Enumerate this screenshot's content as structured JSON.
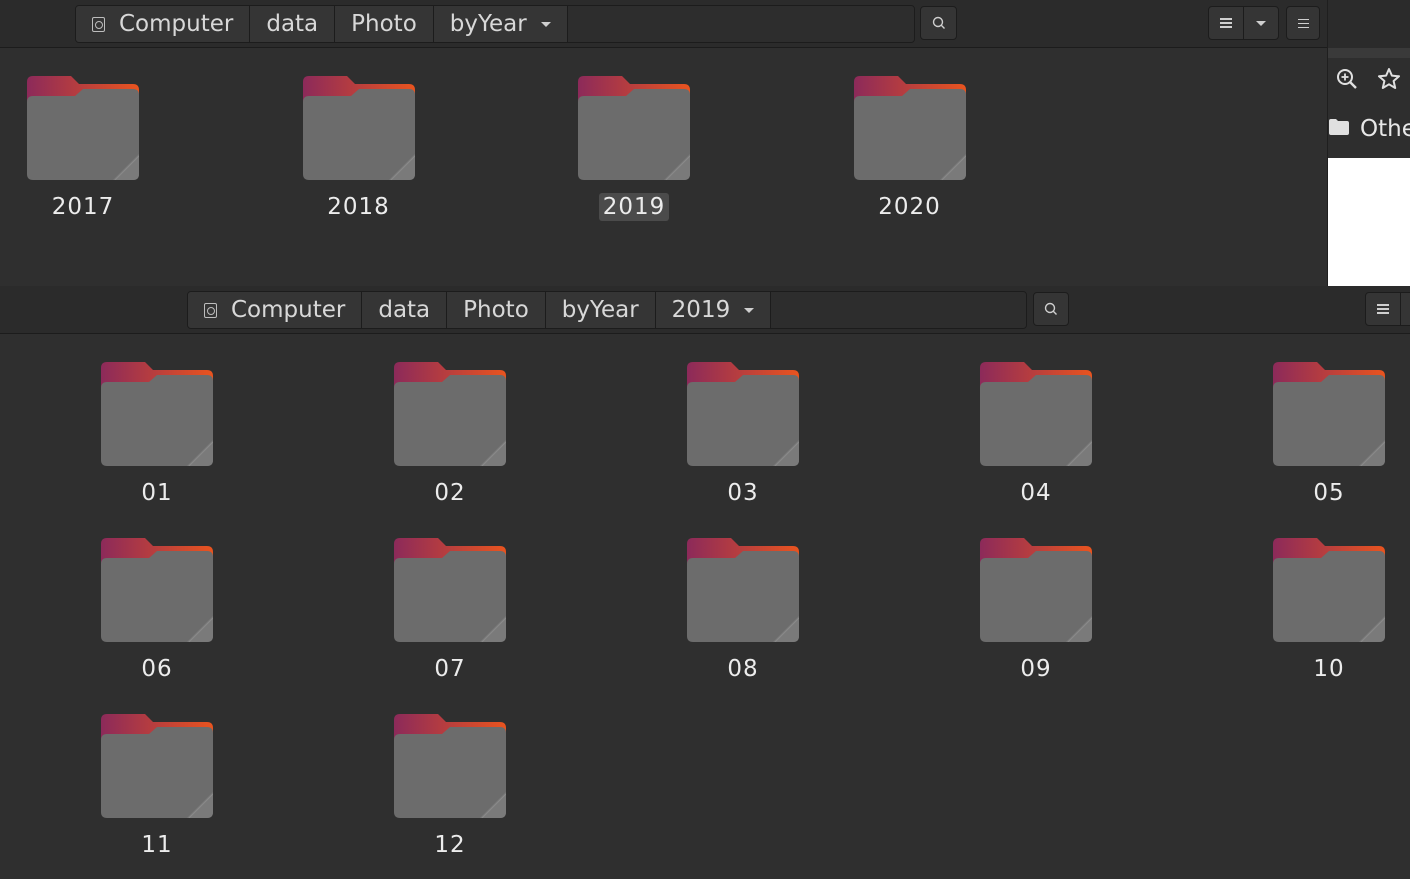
{
  "top_window": {
    "path": [
      "Computer",
      "data",
      "Photo",
      "byYear"
    ],
    "folders": [
      {
        "name": "2017",
        "selected": false
      },
      {
        "name": "2018",
        "selected": false
      },
      {
        "name": "2019",
        "selected": true
      },
      {
        "name": "2020",
        "selected": false
      }
    ]
  },
  "bottom_window": {
    "path": [
      "Computer",
      "data",
      "Photo",
      "byYear",
      "2019"
    ],
    "folders": [
      {
        "name": "01"
      },
      {
        "name": "02"
      },
      {
        "name": "03"
      },
      {
        "name": "04"
      },
      {
        "name": "05"
      },
      {
        "name": "06"
      },
      {
        "name": "07"
      },
      {
        "name": "08"
      },
      {
        "name": "09"
      },
      {
        "name": "10"
      },
      {
        "name": "11"
      },
      {
        "name": "12"
      }
    ]
  },
  "background_browser": {
    "bookmark_label": "Othe"
  },
  "icons": {
    "drive": "drive-icon",
    "search": "search-icon",
    "list_view": "list-view-icon",
    "view_options": "chevron-down-icon",
    "menu": "hamburger-menu-icon",
    "zoom": "zoom-in-icon",
    "star": "star-icon",
    "folder": "folder-icon"
  },
  "colors": {
    "folder_tab_start": "#8c2a5a",
    "folder_tab_end": "#e9541f",
    "folder_body": "#6c6c6c",
    "window_bg": "#2f2f2f"
  }
}
